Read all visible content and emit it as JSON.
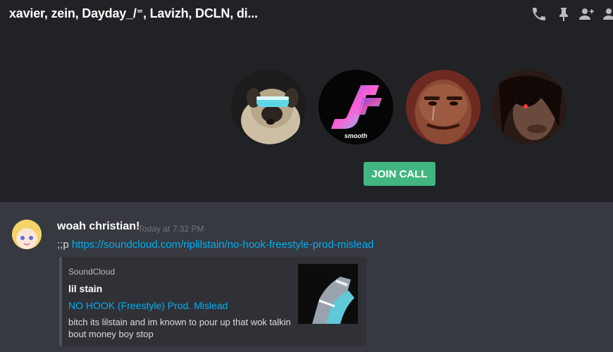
{
  "header": {
    "title": "xavier, zein, Dayday_/⁼, Lavizh, DCLN, di...",
    "icons": [
      "phone-icon",
      "pin-icon",
      "add-friend-icon",
      "members-icon"
    ]
  },
  "call": {
    "participants": [
      "pug-avatar",
      "smooth-logo-avatar",
      "crying-face-avatar",
      "dark-character-avatar"
    ],
    "logo_caption": "smooth",
    "join_label": "JOIN CALL"
  },
  "message": {
    "author": "woah christian!",
    "timestamp": "Today at 7:32 PM",
    "prefix": ";;p ",
    "link": "https://soundcloud.com/riplilstain/no-hook-freestyle-prod-mislead",
    "embed": {
      "provider": "SoundCloud",
      "author": "lil stain",
      "title": "NO HOOK (Freestyle) Prod. Mislead",
      "description": "bitch its lilstain and im known to pour up that wok talkin bout money boy stop"
    }
  },
  "colors": {
    "call_background": "#202225",
    "chat_background": "#36393f",
    "embed_background": "#2f3136",
    "join_button": "#43b581",
    "link": "#00b0f4"
  }
}
